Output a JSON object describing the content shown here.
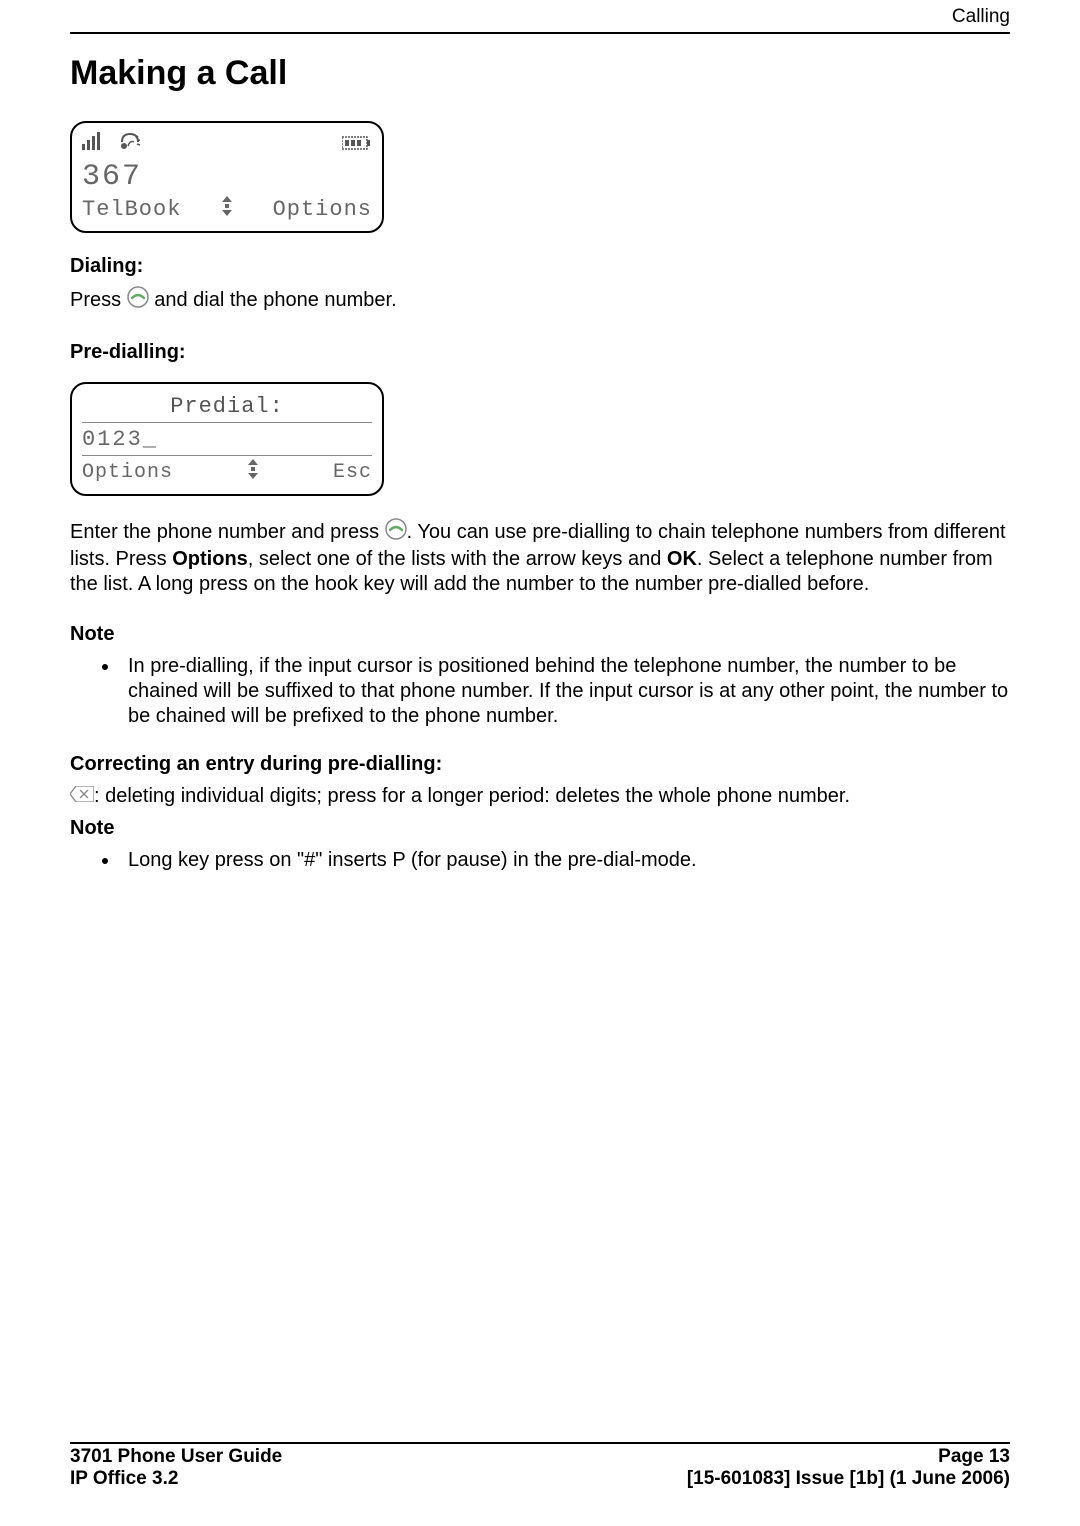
{
  "chapter": "Calling",
  "title": "Making a Call",
  "lcd1": {
    "signal_icon": "signal-icon",
    "ear_icon": "ear-icon",
    "battery_icon": "battery-icon",
    "number": "367",
    "left_soft": "TelBook",
    "arrow_icon": "arrows-icon",
    "right_soft": "Options"
  },
  "dialing": {
    "label": "Dialing:",
    "text_before": "Press ",
    "text_after": " and dial the phone number."
  },
  "predialling_label": "Pre-dialling:",
  "lcd2": {
    "title": "Predial:",
    "number": "0123_",
    "left_soft": "Options",
    "arrow_icon": "arrows-icon",
    "right_soft": "Esc"
  },
  "predial_para_before": "Enter the phone number and press ",
  "predial_para_after": ". You can use pre-dialling to chain telephone numbers from different lists. Press ",
  "predial_options": "Options",
  "predial_mid": ", select one of the lists with the arrow keys and ",
  "predial_ok": "OK",
  "predial_end": ". Select a telephone number from the list. A long press on the hook key will add the number to the number pre-dialled before.",
  "note1_label": "Note",
  "note1_bullet": "In pre-dialling, if the input cursor is positioned behind the telephone number, the number to be chained will be suffixed to that phone number. If the input cursor is at any other point, the number to be chained will be prefixed to the phone number.",
  "correcting_label": "Correcting an entry during pre-dialling:",
  "correcting_text": ": deleting individual digits; press for a longer period: deletes the whole phone number.",
  "note2_label": "Note",
  "note2_bullet": "Long key press on \"#\" inserts P (for pause) in the pre-dial-mode.",
  "footer": {
    "left1": "3701 Phone User Guide",
    "left2": "IP Office 3.2",
    "right1": "Page 13",
    "right2": "[15-601083] Issue [1b] (1 June 2006)"
  }
}
